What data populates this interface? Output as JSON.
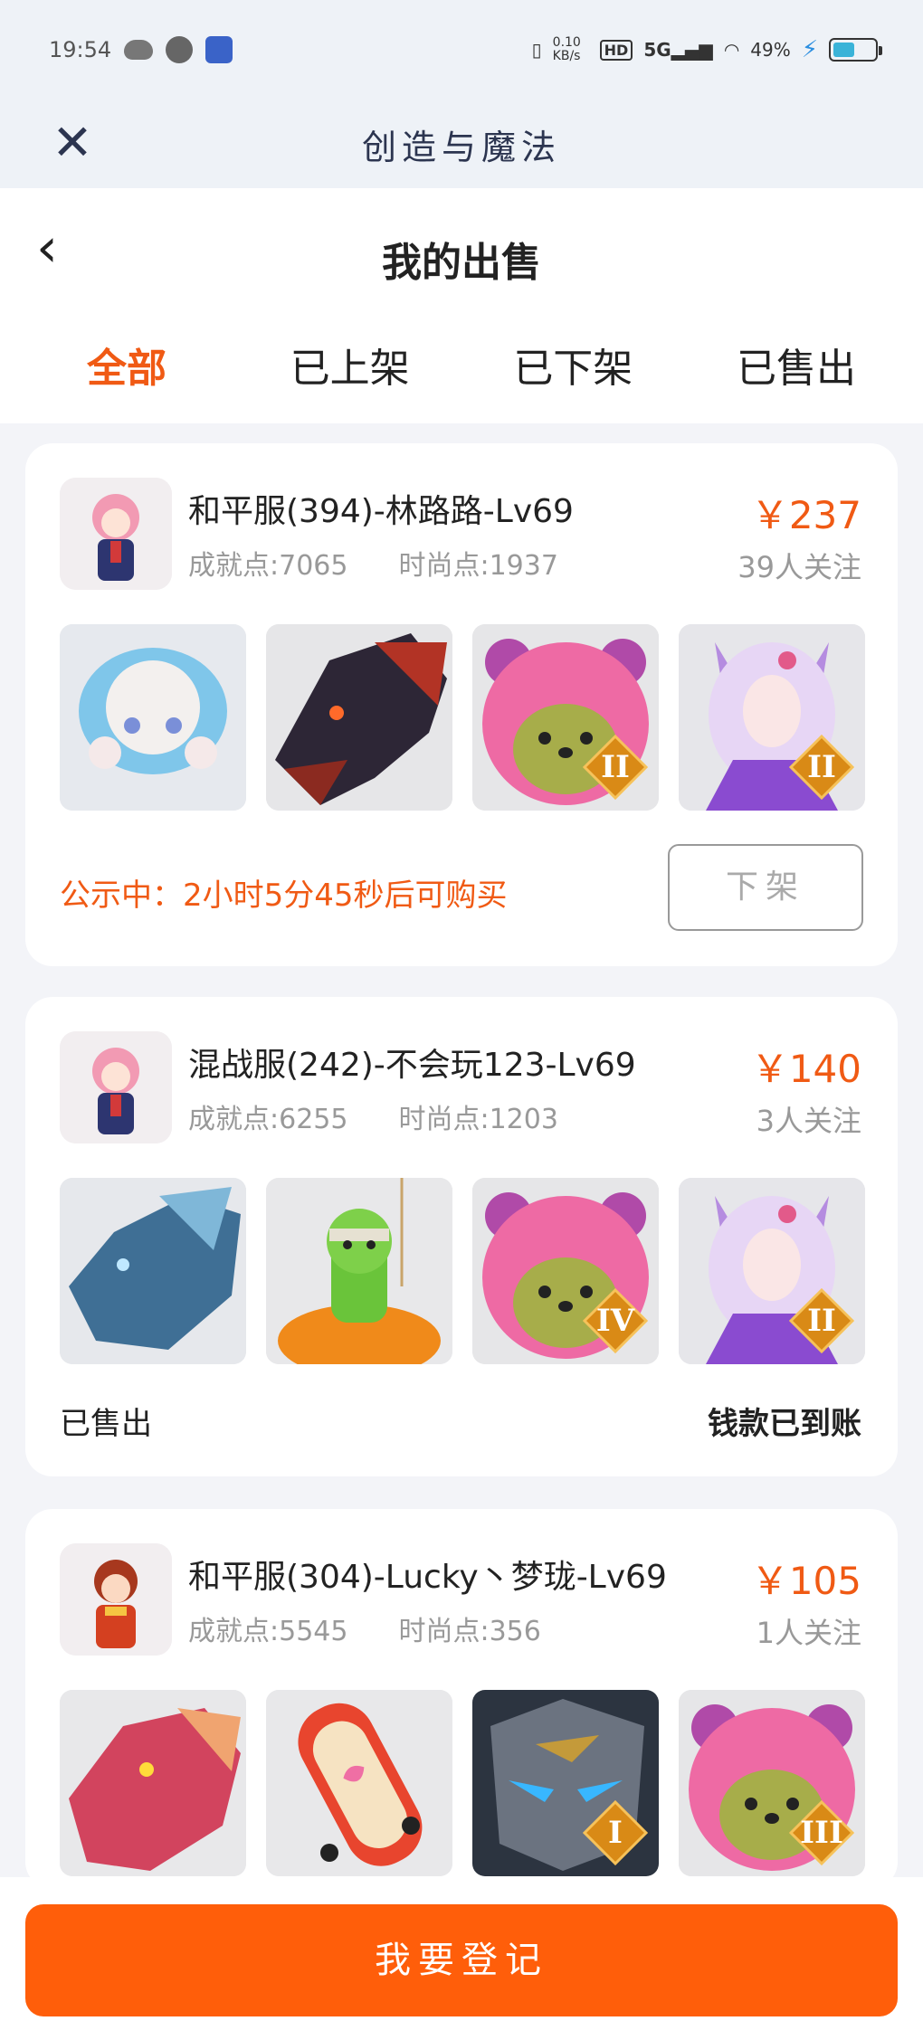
{
  "status_bar": {
    "time": "19:54",
    "network_speed": "0.10 KB/s",
    "hd_label": "HD",
    "signal": "5G",
    "battery": "49%",
    "battery_level": 0.49
  },
  "title_bar": {
    "app_title": "创造与魔法"
  },
  "page": {
    "title": "我的出售",
    "tabs": [
      {
        "label": "全部",
        "active": true
      },
      {
        "label": "已上架",
        "active": false
      },
      {
        "label": "已下架",
        "active": false
      },
      {
        "label": "已售出",
        "active": false
      }
    ]
  },
  "listings": [
    {
      "name": "和平服(394)-林路路-Lv69",
      "achievement": "成就点:7065",
      "fashion": "时尚点:1937",
      "price": "￥237",
      "watchers": "39人关注",
      "items": [
        {
          "icon": "cloud-sheep-mount-icon",
          "rank": ""
        },
        {
          "icon": "dark-dragon-mount-icon",
          "rank": ""
        },
        {
          "icon": "pink-bear-hat-icon",
          "rank": "II"
        },
        {
          "icon": "fox-spirit-outfit-icon",
          "rank": "II"
        }
      ],
      "footer_left": "公示中：2小时5分45秒后可购买",
      "action_label": "下架"
    },
    {
      "name": "混战服(242)-不会玩123-Lv69",
      "achievement": "成就点:6255",
      "fashion": "时尚点:1203",
      "price": "￥140",
      "watchers": "3人关注",
      "items": [
        {
          "icon": "ice-dragon-mount-icon",
          "rank": ""
        },
        {
          "icon": "pumpkin-zombie-icon",
          "rank": ""
        },
        {
          "icon": "pink-bear-hat-icon",
          "rank": "IV"
        },
        {
          "icon": "fox-spirit-outfit-icon",
          "rank": "II"
        }
      ],
      "footer_left": "已售出",
      "footer_right": "钱款已到账"
    },
    {
      "name": "和平服(304)-Lucky丶梦珑-Lv69",
      "achievement": "成就点:5545",
      "fashion": "时尚点:356",
      "price": "￥105",
      "watchers": "1人关注",
      "items": [
        {
          "icon": "red-dragon-mount-icon",
          "rank": ""
        },
        {
          "icon": "skateboard-icon",
          "rank": ""
        },
        {
          "icon": "stone-golem-mount-icon",
          "rank": "I"
        },
        {
          "icon": "pink-bear-hat-icon",
          "rank": "III"
        }
      ]
    }
  ],
  "bottom": {
    "register_label": "我要登记"
  }
}
